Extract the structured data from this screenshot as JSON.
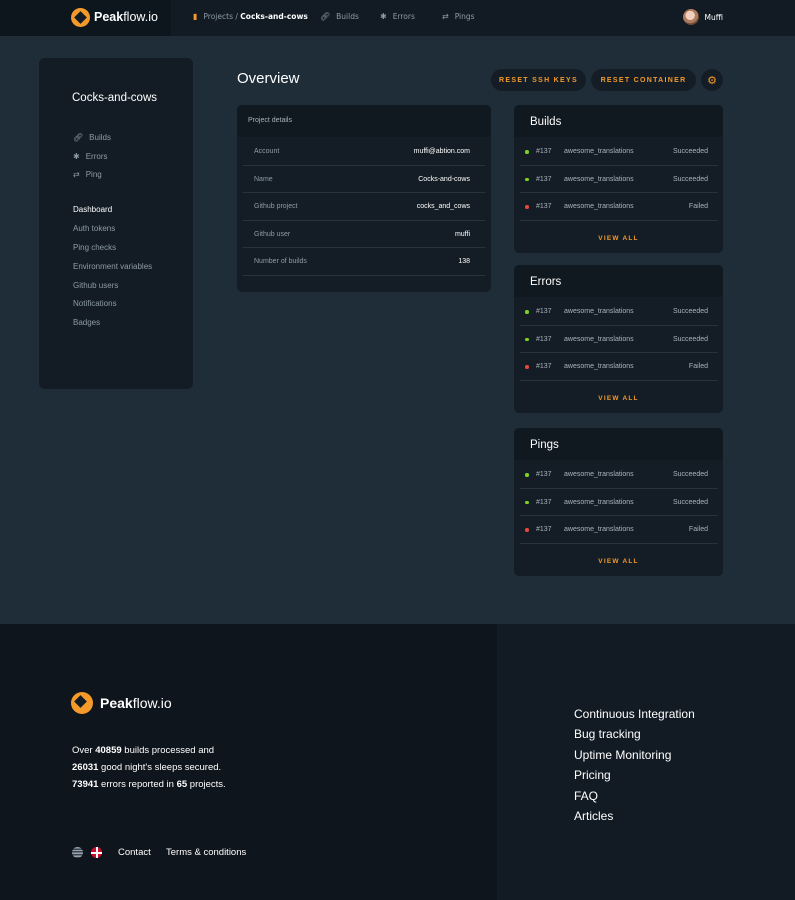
{
  "brand": {
    "name_bold": "Peak",
    "name_rest": "flow.io"
  },
  "nav": {
    "breadcrumb_root": "Projects",
    "breadcrumb_sep": "/",
    "breadcrumb_current": "Cocks-and-cows",
    "builds": "Builds",
    "errors": "Errors",
    "pings": "Pings",
    "user": "Muffi"
  },
  "sidebar": {
    "title": "Cocks-and-cows",
    "quick": [
      "Builds",
      "Errors",
      "Ping"
    ],
    "items": [
      "Dashboard",
      "Auth tokens",
      "Ping checks",
      "Environment variables",
      "Github users",
      "Notifications",
      "Badges"
    ],
    "active": "Dashboard"
  },
  "overview": {
    "title": "Overview",
    "reset_ssh": "RESET SSH KEYS",
    "reset_container": "RESET CONTAINER"
  },
  "details": {
    "heading": "Project details",
    "rows": [
      {
        "key": "Account",
        "value": "muffi@abtion.com"
      },
      {
        "key": "Name",
        "value": "Cocks-and-cows"
      },
      {
        "key": "Github project",
        "value": "cocks_and_cows"
      },
      {
        "key": "Github user",
        "value": "muffi"
      },
      {
        "key": "Number of builds",
        "value": "138"
      }
    ]
  },
  "colors": {
    "accent": "#f39a2a",
    "success": "#7ed321",
    "fail": "#e2483d"
  },
  "builds": {
    "title": "Builds",
    "rows": [
      {
        "num": "#137",
        "name": "awesome_translations",
        "status": "Succeeded"
      },
      {
        "num": "#137",
        "name": "awesome_translations",
        "status": "Succeeded"
      },
      {
        "num": "#137",
        "name": "awesome_translations",
        "status": "Failed"
      }
    ],
    "view_all": "VIEW ALL"
  },
  "errors": {
    "title": "Errors",
    "rows": [
      {
        "num": "#137",
        "name": "awesome_translations",
        "status": "Succeeded"
      },
      {
        "num": "#137",
        "name": "awesome_translations",
        "status": "Succeeded"
      },
      {
        "num": "#137",
        "name": "awesome_translations",
        "status": "Failed"
      }
    ],
    "view_all": "VIEW ALL"
  },
  "pings": {
    "title": "Pings",
    "rows": [
      {
        "num": "#137",
        "name": "awesome_translations",
        "status": "Succeeded"
      },
      {
        "num": "#137",
        "name": "awesome_translations",
        "status": "Succeeded"
      },
      {
        "num": "#137",
        "name": "awesome_translations",
        "status": "Failed"
      }
    ],
    "view_all": "VIEW ALL"
  },
  "footer": {
    "stats": {
      "pre1": "Over ",
      "builds": "40859",
      "post1": " builds processed and",
      "sleeps": "26031",
      "post2": " good night's sleeps secured.",
      "errors": "73941",
      "mid3": " errors reported in ",
      "projects": "65",
      "post3": " projects."
    },
    "contact": "Contact",
    "terms": "Terms & conditions",
    "links": [
      "Continuous Integration",
      "Bug tracking",
      "Uptime Monitoring",
      "Pricing",
      "FAQ",
      "Articles"
    ]
  }
}
